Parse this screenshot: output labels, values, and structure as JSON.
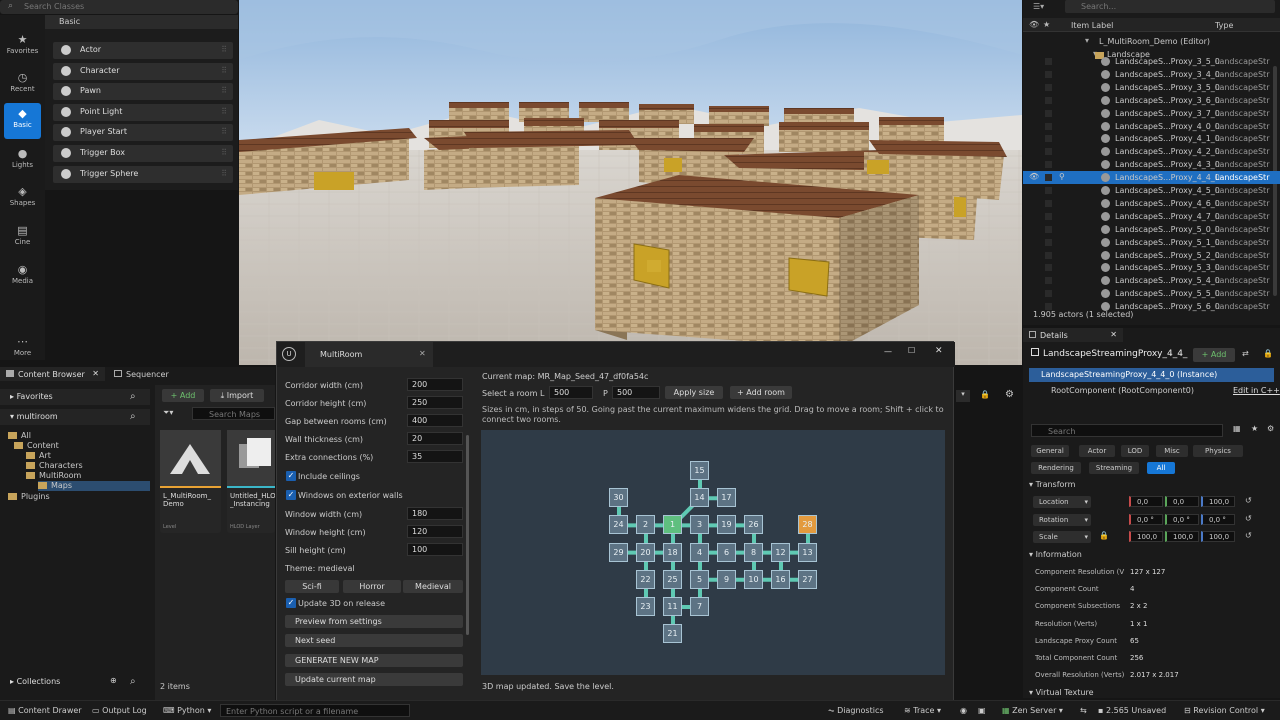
{
  "place_actors": {
    "search_placeholder": "Search Classes",
    "category": "Basic",
    "nav": [
      {
        "label": "Favorites",
        "icon": "star-icon"
      },
      {
        "label": "Recent",
        "icon": "clock-icon"
      },
      {
        "label": "Basic",
        "icon": "cube-icon"
      },
      {
        "label": "Lights",
        "icon": "bulb-icon"
      },
      {
        "label": "Shapes",
        "icon": "shapes-icon"
      },
      {
        "label": "Cine",
        "icon": "film-icon"
      },
      {
        "label": "Media",
        "icon": "media-icon"
      },
      {
        "label": "More",
        "icon": "ellipsis-icon"
      }
    ],
    "items": [
      "Actor",
      "Character",
      "Pawn",
      "Point Light",
      "Player Start",
      "Trigger Box",
      "Trigger Sphere"
    ]
  },
  "outliner": {
    "search_placeholder": "Search...",
    "col_label": "Item Label",
    "col_type": "Type",
    "root": "L_MultiRoom_Demo (Editor)",
    "folder": "Landscape",
    "rows": [
      "LandscapeS...Proxy_3_5_0",
      "LandscapeS...Proxy_3_4_0",
      "LandscapeS...Proxy_3_5_0",
      "LandscapeS...Proxy_3_6_0",
      "LandscapeS...Proxy_3_7_0",
      "LandscapeS...Proxy_4_0_0",
      "LandscapeS...Proxy_4_1_0",
      "LandscapeS...Proxy_4_2_0",
      "LandscapeS...Proxy_4_3_0",
      "LandscapeS...Proxy_4_4_0",
      "LandscapeS...Proxy_4_5_0",
      "LandscapeS...Proxy_4_6_0",
      "LandscapeS...Proxy_4_7_0",
      "LandscapeS...Proxy_5_0_0",
      "LandscapeS...Proxy_5_1_0",
      "LandscapeS...Proxy_5_2_0",
      "LandscapeS...Proxy_5_3_0",
      "LandscapeS...Proxy_5_4_0",
      "LandscapeS...Proxy_5_5_0",
      "LandscapeS...Proxy_5_6_0"
    ],
    "type_value": "LandscapeStr",
    "selected_index": 9,
    "footer": "1.905 actors (1 selected)"
  },
  "details": {
    "tab": "Details",
    "object_name": "LandscapeStreamingProxy_4_4_",
    "add_label": "+ Add",
    "instance": "LandscapeStreamingProxy_4_4_0 (Instance)",
    "root_component": "RootComponent (RootComponent0)",
    "edit_cpp": "Edit in C++",
    "search_placeholder": "Search",
    "filters": [
      "General",
      "Actor",
      "LOD",
      "Misc",
      "Physics",
      "Rendering",
      "Streaming",
      "All"
    ],
    "transform_title": "Transform",
    "transform": [
      {
        "label": "Location",
        "values": [
          "0,0",
          "0,0",
          "100,0"
        ]
      },
      {
        "label": "Rotation",
        "values": [
          "0,0 °",
          "0,0 °",
          "0,0 °"
        ]
      },
      {
        "label": "Scale",
        "values": [
          "100,0",
          "100,0",
          "100,0"
        ]
      }
    ],
    "info_title": "Information",
    "info": [
      {
        "k": "Component Resolution (V",
        "v": "127 x 127"
      },
      {
        "k": "Component Count",
        "v": "4"
      },
      {
        "k": "Component Subsections",
        "v": "2 x 2"
      },
      {
        "k": "Resolution (Verts)",
        "v": "1 x 1"
      },
      {
        "k": "Landscape Proxy Count",
        "v": "65"
      },
      {
        "k": "Total Component Count",
        "v": "256"
      },
      {
        "k": "Overall Resolution (Verts)",
        "v": "2.017 x 2.017"
      }
    ],
    "virtual_texture": "Virtual Texture"
  },
  "content": {
    "tab1": "Content Browser",
    "tab2": "Sequencer",
    "favorites": "Favorites",
    "project": "multiroom",
    "tree": [
      "All",
      "Content",
      "Art",
      "Characters",
      "MultiRoom",
      "Maps",
      "Plugins"
    ],
    "collections": "Collections",
    "add": "+ Add",
    "import": "Import",
    "search_placeholder": "Search Maps",
    "assets": [
      {
        "name": "L_MultiRoom_ Demo",
        "type": "Level"
      },
      {
        "name": "Untitled_HLO _Instancing",
        "type": "HLOD Layer"
      }
    ],
    "count": "2 items"
  },
  "dialog": {
    "title": "MultiRoom",
    "settings": [
      {
        "label": "Corridor width (cm)",
        "value": "200"
      },
      {
        "label": "Corridor height (cm)",
        "value": "250"
      },
      {
        "label": "Gap between rooms (cm)",
        "value": "400"
      },
      {
        "label": "Wall thickness (cm)",
        "value": "20"
      },
      {
        "label": "Extra connections (%)",
        "value": "35"
      }
    ],
    "include_ceilings": "Include ceilings",
    "windows_exterior": "Windows on exterior walls",
    "settings2": [
      {
        "label": "Window width (cm)",
        "value": "180"
      },
      {
        "label": "Window height (cm)",
        "value": "120"
      },
      {
        "label": "Sill height (cm)",
        "value": "100"
      }
    ],
    "theme": "Theme: medieval",
    "themes": [
      "Sci-fi",
      "Horror",
      "Medieval"
    ],
    "update_3d": "Update 3D on release",
    "buttons": [
      "Preview from settings",
      "Next seed",
      "GENERATE NEW MAP",
      "Update current map"
    ],
    "current_map": "Current map: MR_Map_Seed_47_df0fa54c",
    "select_room": "Select a room",
    "l_label": "L",
    "l_value": "500",
    "p_label": "P",
    "p_value": "500",
    "apply": "Apply size",
    "add_room": "+ Add room",
    "hint": "Sizes in cm, in steps of 50. Going past the current maximum widens the grid. Drag to move a room; Shift + click to connect two rooms.",
    "status": "3D map updated. Save the level.",
    "rooms": [
      {
        "n": "15",
        "c": 3,
        "r": 0
      },
      {
        "n": "30",
        "c": 0,
        "r": 1
      },
      {
        "n": "14",
        "c": 3,
        "r": 1
      },
      {
        "n": "17",
        "c": 4,
        "r": 1
      },
      {
        "n": "24",
        "c": 0,
        "r": 2
      },
      {
        "n": "2",
        "c": 1,
        "r": 2
      },
      {
        "n": "1",
        "c": 2,
        "r": 2,
        "s": "start"
      },
      {
        "n": "3",
        "c": 3,
        "r": 2
      },
      {
        "n": "19",
        "c": 4,
        "r": 2
      },
      {
        "n": "26",
        "c": 5,
        "r": 2
      },
      {
        "n": "28",
        "c": 7,
        "r": 2,
        "s": "hl"
      },
      {
        "n": "29",
        "c": 0,
        "r": 3
      },
      {
        "n": "20",
        "c": 1,
        "r": 3
      },
      {
        "n": "18",
        "c": 2,
        "r": 3
      },
      {
        "n": "4",
        "c": 3,
        "r": 3
      },
      {
        "n": "6",
        "c": 4,
        "r": 3
      },
      {
        "n": "8",
        "c": 5,
        "r": 3
      },
      {
        "n": "12",
        "c": 6,
        "r": 3
      },
      {
        "n": "13",
        "c": 7,
        "r": 3
      },
      {
        "n": "22",
        "c": 1,
        "r": 4
      },
      {
        "n": "25",
        "c": 2,
        "r": 4
      },
      {
        "n": "5",
        "c": 3,
        "r": 4
      },
      {
        "n": "9",
        "c": 4,
        "r": 4
      },
      {
        "n": "10",
        "c": 5,
        "r": 4
      },
      {
        "n": "16",
        "c": 6,
        "r": 4
      },
      {
        "n": "27",
        "c": 7,
        "r": 4
      },
      {
        "n": "23",
        "c": 1,
        "r": 5
      },
      {
        "n": "11",
        "c": 2,
        "r": 5
      },
      {
        "n": "7",
        "c": 3,
        "r": 5
      },
      {
        "n": "21",
        "c": 2,
        "r": 6
      }
    ],
    "links": [
      [
        "15",
        "14"
      ],
      [
        "14",
        "17"
      ],
      [
        "14",
        "1"
      ],
      [
        "30",
        "24"
      ],
      [
        "24",
        "2"
      ],
      [
        "2",
        "1"
      ],
      [
        "1",
        "3"
      ],
      [
        "3",
        "19"
      ],
      [
        "19",
        "26"
      ],
      [
        "28",
        "13"
      ],
      [
        "2",
        "20"
      ],
      [
        "29",
        "20"
      ],
      [
        "20",
        "18"
      ],
      [
        "1",
        "18"
      ],
      [
        "3",
        "4"
      ],
      [
        "4",
        "6"
      ],
      [
        "6",
        "8"
      ],
      [
        "8",
        "12"
      ],
      [
        "12",
        "13"
      ],
      [
        "26",
        "8"
      ],
      [
        "20",
        "22"
      ],
      [
        "22",
        "23"
      ],
      [
        "18",
        "25"
      ],
      [
        "4",
        "5"
      ],
      [
        "5",
        "9"
      ],
      [
        "9",
        "10"
      ],
      [
        "10",
        "16"
      ],
      [
        "16",
        "27"
      ],
      [
        "16",
        "12"
      ],
      [
        "8",
        "10"
      ],
      [
        "25",
        "11"
      ],
      [
        "11",
        "7"
      ],
      [
        "5",
        "7"
      ],
      [
        "11",
        "21"
      ]
    ]
  },
  "statusbar": {
    "content_drawer": "Content Drawer",
    "output_log": "Output Log",
    "python": "Python",
    "cmd_placeholder": "Enter Python script or a filename",
    "diagnostics": "Diagnostics",
    "trace": "Trace",
    "zen": "Zen Server",
    "unsaved": "2.565 Unsaved",
    "revision": "Revision Control"
  }
}
